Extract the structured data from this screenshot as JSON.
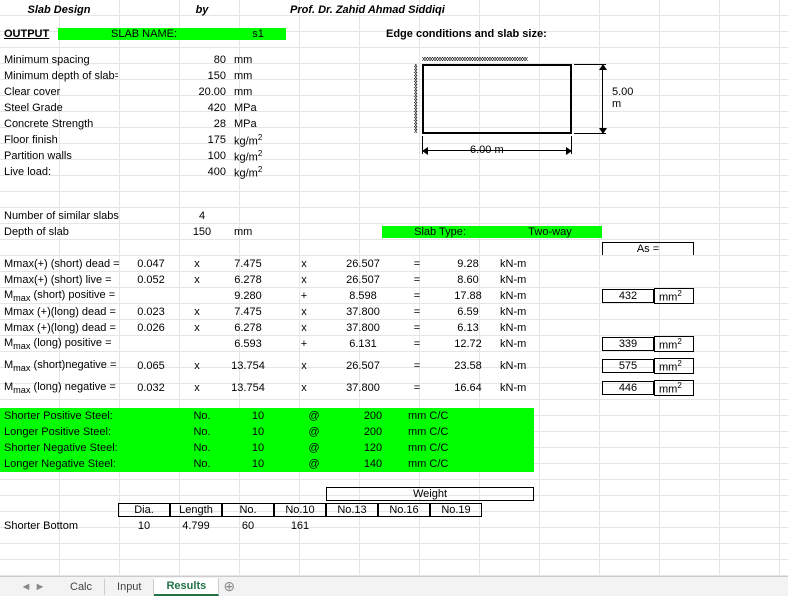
{
  "header": {
    "slab_design": "Slab Design",
    "by": "by",
    "author": "Prof. Dr. Zahid Ahmad Siddiqi"
  },
  "output_label": "OUTPUT",
  "slab_name_label": "SLAB NAME:",
  "slab_name_value": "s1",
  "edge_conditions_label": "Edge conditions and slab size:",
  "params": [
    {
      "label": "Minimum spacing",
      "value": "80",
      "unit": "mm"
    },
    {
      "label": "Minimum depth of slab=",
      "value": "150",
      "unit": "mm"
    },
    {
      "label": "Clear cover",
      "value": "20.00",
      "unit": "mm"
    },
    {
      "label": "Steel Grade",
      "value": "420",
      "unit": "MPa"
    },
    {
      "label": "Concrete Strength",
      "value": "28",
      "unit": "MPa"
    },
    {
      "label": "Floor finish",
      "value": "175",
      "unit_html": "kg/m²"
    },
    {
      "label": "Partition walls",
      "value": "100",
      "unit_html": "kg/m²"
    },
    {
      "label": "Live load:",
      "value": "400",
      "unit_html": "kg/m²"
    }
  ],
  "similarity": {
    "label": "Number of similar slabs",
    "value": "4"
  },
  "depth": {
    "label": "Depth of slab",
    "value": "150",
    "unit": "mm"
  },
  "diagram": {
    "height": "5.00",
    "height_unit": "m",
    "width": "6.00",
    "width_unit": "m"
  },
  "slab_type": {
    "label": "Slab Type:",
    "value": "Two-way"
  },
  "as_label": "As =",
  "moments": [
    {
      "label": "Mmax(+) (short) dead =",
      "c1": "0.047",
      "op1": "x",
      "c2": "7.475",
      "op2": "x",
      "c3": "26.507",
      "eq": "=",
      "c4": "9.28",
      "unit": "kN-m",
      "as": "",
      "asu": ""
    },
    {
      "label": "Mmax(+) (short) live =",
      "c1": "0.052",
      "op1": "x",
      "c2": "6.278",
      "op2": "x",
      "c3": "26.507",
      "eq": "=",
      "c4": "8.60",
      "unit": "kN-m",
      "as": "",
      "asu": ""
    },
    {
      "label_html": "M<sub>max</sub> (short) positive =",
      "c1": "",
      "op1": "",
      "c2": "9.280",
      "op2": "+",
      "c3": "8.598",
      "eq": "=",
      "c4": "17.88",
      "unit": "kN-m",
      "as": "432",
      "asu": "mm²"
    },
    {
      "label": "Mmax (+)(long) dead =",
      "c1": "0.023",
      "op1": "x",
      "c2": "7.475",
      "op2": "x",
      "c3": "37.800",
      "eq": "=",
      "c4": "6.59",
      "unit": "kN-m",
      "as": "",
      "asu": ""
    },
    {
      "label": "Mmax (+)(long) dead =",
      "c1": "0.026",
      "op1": "x",
      "c2": "6.278",
      "op2": "x",
      "c3": "37.800",
      "eq": "=",
      "c4": "6.13",
      "unit": "kN-m",
      "as": "",
      "asu": ""
    },
    {
      "label_html": "M<sub>max</sub> (long) positive =",
      "c1": "",
      "op1": "",
      "c2": "6.593",
      "op2": "+",
      "c3": "6.131",
      "eq": "=",
      "c4": "12.72",
      "unit": "kN-m",
      "as": "339",
      "asu": "mm²"
    },
    {
      "label_html": "M<sub>max</sub> (short)negative =",
      "c1": "0.065",
      "op1": "x",
      "c2": "13.754",
      "op2": "x",
      "c3": "26.507",
      "eq": "=",
      "c4": "23.58",
      "unit": "kN-m",
      "as": "575",
      "asu": "mm²"
    },
    {
      "label_html": "M<sub>max</sub> (long) negative =",
      "c1": "0.032",
      "op1": "x",
      "c2": "13.754",
      "op2": "x",
      "c3": "37.800",
      "eq": "=",
      "c4": "16.64",
      "unit": "kN-m",
      "as": "446",
      "asu": "mm²"
    }
  ],
  "steel": [
    {
      "label": "Shorter Positive Steel:",
      "no_lbl": "No.",
      "no": "10",
      "at": "@",
      "sp": "200",
      "unit": "mm C/C"
    },
    {
      "label": "Longer Positive Steel:",
      "no_lbl": "No.",
      "no": "10",
      "at": "@",
      "sp": "200",
      "unit": "mm C/C"
    },
    {
      "label": "Shorter Negative Steel:",
      "no_lbl": "No.",
      "no": "10",
      "at": "@",
      "sp": "120",
      "unit": "mm C/C"
    },
    {
      "label": "Longer Negative Steel:",
      "no_lbl": "No.",
      "no": "10",
      "at": "@",
      "sp": "140",
      "unit": "mm C/C"
    }
  ],
  "weight_table": {
    "header": "Weight",
    "cols": [
      "Dia.",
      "Length",
      "No.",
      "No.10",
      "No.13",
      "No.16",
      "No.19"
    ],
    "row_label": "Shorter Bottom",
    "row": [
      "10",
      "4.799",
      "60",
      "161",
      "",
      "",
      ""
    ]
  },
  "tabs": {
    "items": [
      "Calc",
      "Input",
      "Results"
    ],
    "active": "Results"
  }
}
